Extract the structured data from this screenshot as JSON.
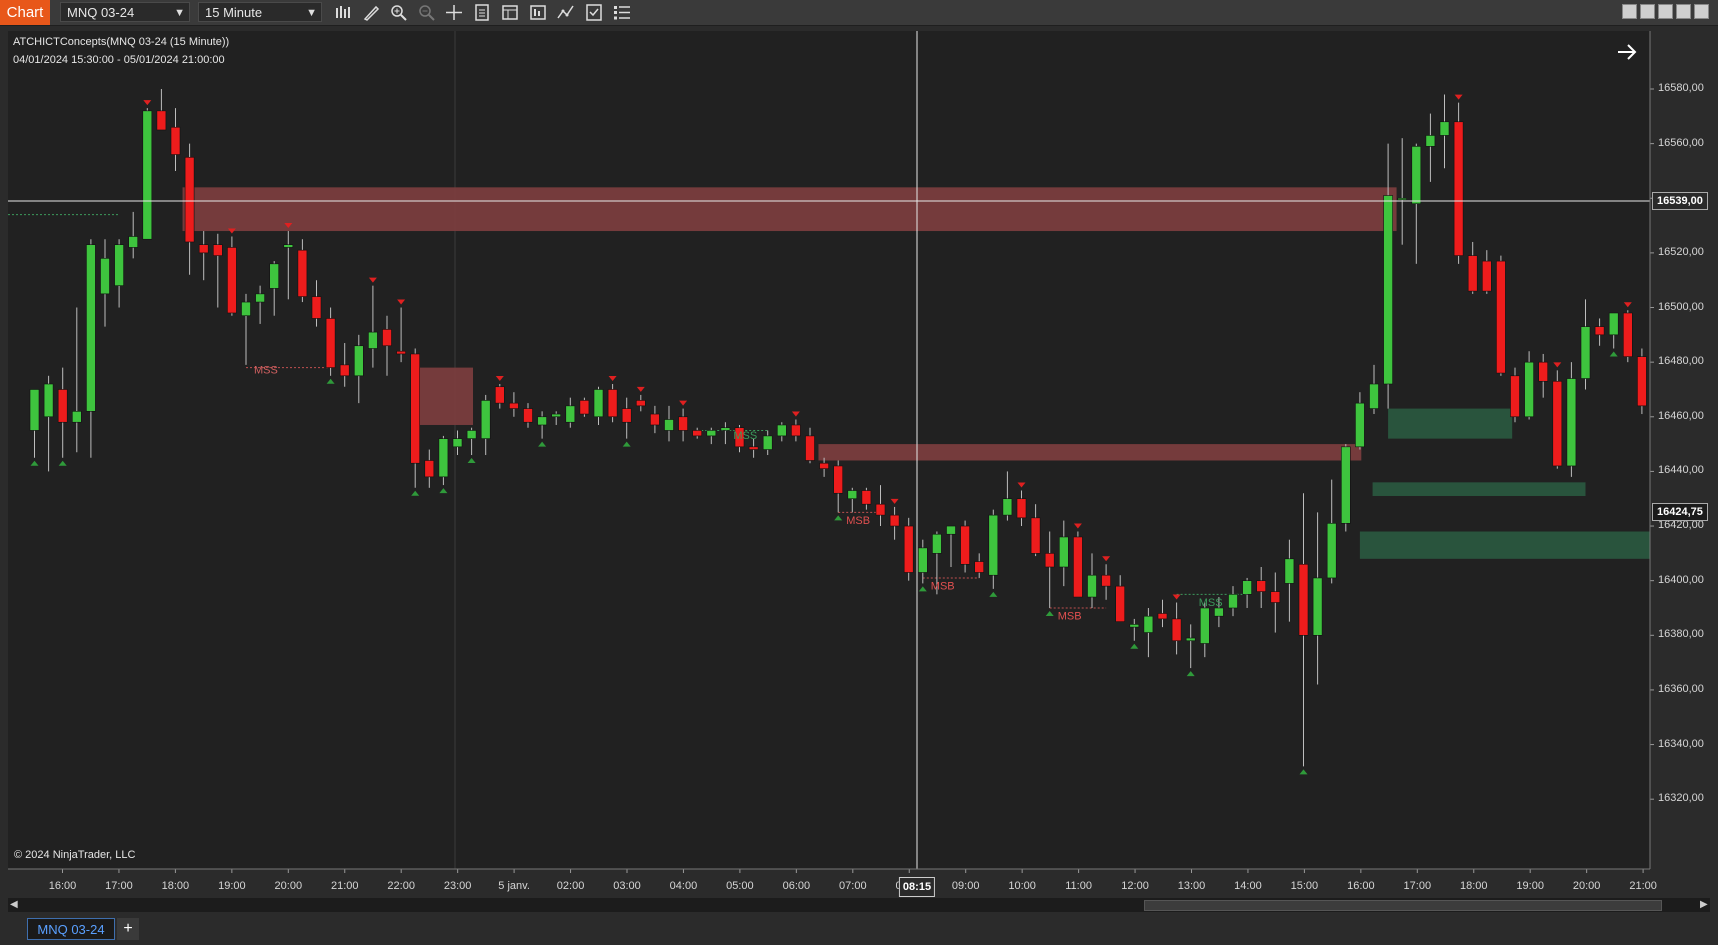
{
  "toolbar": {
    "chart_button": "Chart",
    "instrument_select": "MNQ 03-24",
    "interval_select": "15 Minute",
    "icons": [
      "bar-type-icon",
      "drawing-tools-icon",
      "zoom-in-icon",
      "zoom-out-icon",
      "crosshair-icon",
      "data-box-icon",
      "chart-style-icon",
      "templates-icon",
      "indicators-icon",
      "strategies-icon",
      "properties-icon"
    ]
  },
  "chart": {
    "indicator_title": "ATCHICTConcepts(MNQ 03-24 (15 Minute))",
    "date_range": "04/01/2024 15:30:00 - 05/01/2024 21:00:00",
    "copyright": "© 2024 NinjaTrader, LLC",
    "crosshair_price_tag": "16539,00",
    "last_price_tag": "16424,75",
    "crosshair_time_tag": "08:15",
    "colors": {
      "background": "#212121",
      "up_candle": "#3ec43e",
      "down_candle": "#ee1c1c",
      "bearish_zone": "#7a3d3e",
      "bullish_zone": "#2a5a40",
      "msb_label": "#e05050",
      "mss_bear_label": "#d06060",
      "mss_bull_label": "#3c9a5c"
    }
  },
  "y_axis": {
    "labels": [
      "16580,00",
      "16560,00",
      "16540,00",
      "16520,00",
      "16500,00",
      "16480,00",
      "16460,00",
      "16440,00",
      "16420,00",
      "16400,00",
      "16380,00",
      "16360,00",
      "16340,00",
      "16320,00"
    ],
    "values": [
      16580,
      16560,
      16540,
      16520,
      16500,
      16480,
      16460,
      16440,
      16420,
      16400,
      16380,
      16360,
      16340,
      16320
    ]
  },
  "x_axis": {
    "labels": [
      "16:00",
      "17:00",
      "18:00",
      "19:00",
      "20:00",
      "21:00",
      "22:00",
      "23:00",
      "5 janv.",
      "02:00",
      "03:00",
      "04:00",
      "05:00",
      "06:00",
      "07:00",
      "08:00",
      "09:00",
      "10:00",
      "11:00",
      "12:00",
      "13:00",
      "14:00",
      "15:00",
      "16:00",
      "17:00",
      "18:00",
      "19:00",
      "20:00",
      "21:00"
    ],
    "hour_offsets": [
      0.5,
      1.5,
      2.5,
      3.5,
      4.5,
      5.5,
      6.5,
      7.5,
      8.5,
      9.5,
      10.5,
      11.5,
      12.5,
      13.5,
      14.5,
      15.5,
      16.5,
      17.5,
      18.5,
      19.5,
      20.5,
      21.5,
      22.5,
      23.5,
      24.5,
      25.5,
      26.5,
      27.5,
      28.5
    ]
  },
  "annotations": [
    {
      "text": "MSS",
      "bar": 15,
      "price": 16478
    },
    {
      "text": "MSS",
      "bar": 49,
      "price": 16454
    },
    {
      "text": "MSB",
      "bar": 57,
      "price": 16423
    },
    {
      "text": "MSB",
      "bar": 63,
      "price": 16399
    },
    {
      "text": "MSB",
      "bar": 72,
      "price": 16388
    },
    {
      "text": "MSS",
      "bar": 82,
      "price": 16393
    }
  ],
  "chart_data": {
    "type": "candlestick",
    "y_range": [
      16320,
      16590
    ],
    "bars": [
      {
        "o": 16455,
        "h": 16468,
        "l": 16445,
        "c": 16470
      },
      {
        "o": 16460,
        "h": 16475,
        "l": 16440,
        "c": 16472
      },
      {
        "o": 16470,
        "h": 16478,
        "l": 16445,
        "c": 16458
      },
      {
        "o": 16458,
        "h": 16500,
        "l": 16447,
        "c": 16462
      },
      {
        "o": 16462,
        "h": 16525,
        "l": 16445,
        "c": 16523
      },
      {
        "o": 16505,
        "h": 16525,
        "l": 16493,
        "c": 16518
      },
      {
        "o": 16508,
        "h": 16525,
        "l": 16500,
        "c": 16523
      },
      {
        "o": 16522,
        "h": 16535,
        "l": 16518,
        "c": 16526
      },
      {
        "o": 16525,
        "h": 16573,
        "l": 16525,
        "c": 16572
      },
      {
        "o": 16572,
        "h": 16580,
        "l": 16566,
        "c": 16565
      },
      {
        "o": 16566,
        "h": 16573,
        "l": 16550,
        "c": 16556
      },
      {
        "o": 16555,
        "h": 16560,
        "l": 16512,
        "c": 16524
      },
      {
        "o": 16523,
        "h": 16528,
        "l": 16510,
        "c": 16520
      },
      {
        "o": 16523,
        "h": 16527,
        "l": 16500,
        "c": 16519
      },
      {
        "o": 16522,
        "h": 16526,
        "l": 16497,
        "c": 16498
      },
      {
        "o": 16497,
        "h": 16505,
        "l": 16479,
        "c": 16502
      },
      {
        "o": 16502,
        "h": 16508,
        "l": 16494,
        "c": 16505
      },
      {
        "o": 16507,
        "h": 16517,
        "l": 16497,
        "c": 16516
      },
      {
        "o": 16522,
        "h": 16528,
        "l": 16503,
        "c": 16523
      },
      {
        "o": 16521,
        "h": 16525,
        "l": 16502,
        "c": 16504
      },
      {
        "o": 16504,
        "h": 16510,
        "l": 16493,
        "c": 16496
      },
      {
        "o": 16496,
        "h": 16500,
        "l": 16475,
        "c": 16478
      },
      {
        "o": 16479,
        "h": 16487,
        "l": 16471,
        "c": 16475
      },
      {
        "o": 16475,
        "h": 16490,
        "l": 16465,
        "c": 16486
      },
      {
        "o": 16485,
        "h": 16508,
        "l": 16478,
        "c": 16491
      },
      {
        "o": 16492,
        "h": 16497,
        "l": 16475,
        "c": 16486
      },
      {
        "o": 16484,
        "h": 16500,
        "l": 16480,
        "c": 16483
      },
      {
        "o": 16483,
        "h": 16485,
        "l": 16434,
        "c": 16443
      },
      {
        "o": 16444,
        "h": 16448,
        "l": 16434,
        "c": 16438
      },
      {
        "o": 16438,
        "h": 16453,
        "l": 16435,
        "c": 16452
      },
      {
        "o": 16449,
        "h": 16455,
        "l": 16446,
        "c": 16452
      },
      {
        "o": 16452,
        "h": 16456,
        "l": 16446,
        "c": 16455
      },
      {
        "o": 16452,
        "h": 16468,
        "l": 16446,
        "c": 16466
      },
      {
        "o": 16471,
        "h": 16472,
        "l": 16463,
        "c": 16465
      },
      {
        "o": 16465,
        "h": 16469,
        "l": 16460,
        "c": 16463
      },
      {
        "o": 16463,
        "h": 16465,
        "l": 16456,
        "c": 16458
      },
      {
        "o": 16457,
        "h": 16462,
        "l": 16452,
        "c": 16460
      },
      {
        "o": 16460,
        "h": 16462,
        "l": 16457,
        "c": 16461
      },
      {
        "o": 16458,
        "h": 16467,
        "l": 16456,
        "c": 16464
      },
      {
        "o": 16466,
        "h": 16467,
        "l": 16460,
        "c": 16461
      },
      {
        "o": 16460,
        "h": 16471,
        "l": 16457,
        "c": 16470
      },
      {
        "o": 16470,
        "h": 16472,
        "l": 16458,
        "c": 16460
      },
      {
        "o": 16463,
        "h": 16467,
        "l": 16452,
        "c": 16458
      },
      {
        "o": 16466,
        "h": 16468,
        "l": 16462,
        "c": 16464
      },
      {
        "o": 16461,
        "h": 16464,
        "l": 16454,
        "c": 16457
      },
      {
        "o": 16455,
        "h": 16464,
        "l": 16451,
        "c": 16459
      },
      {
        "o": 16460,
        "h": 16463,
        "l": 16451,
        "c": 16455
      },
      {
        "o": 16455,
        "h": 16456,
        "l": 16452,
        "c": 16453
      },
      {
        "o": 16453,
        "h": 16456,
        "l": 16450,
        "c": 16455
      },
      {
        "o": 16455,
        "h": 16458,
        "l": 16450,
        "c": 16456
      },
      {
        "o": 16456,
        "h": 16457,
        "l": 16447,
        "c": 16449
      },
      {
        "o": 16449,
        "h": 16452,
        "l": 16445,
        "c": 16448
      },
      {
        "o": 16448,
        "h": 16455,
        "l": 16446,
        "c": 16453
      },
      {
        "o": 16453,
        "h": 16458,
        "l": 16451,
        "c": 16457
      },
      {
        "o": 16457,
        "h": 16459,
        "l": 16451,
        "c": 16453
      },
      {
        "o": 16453,
        "h": 16456,
        "l": 16443,
        "c": 16444
      },
      {
        "o": 16443,
        "h": 16445,
        "l": 16438,
        "c": 16441
      },
      {
        "o": 16442,
        "h": 16444,
        "l": 16425,
        "c": 16432
      },
      {
        "o": 16430,
        "h": 16434,
        "l": 16425,
        "c": 16433
      },
      {
        "o": 16433,
        "h": 16434,
        "l": 16426,
        "c": 16428
      },
      {
        "o": 16428,
        "h": 16435,
        "l": 16420,
        "c": 16424
      },
      {
        "o": 16424,
        "h": 16427,
        "l": 16415,
        "c": 16420
      },
      {
        "o": 16420,
        "h": 16423,
        "l": 16400,
        "c": 16403
      },
      {
        "o": 16403,
        "h": 16415,
        "l": 16399,
        "c": 16412
      },
      {
        "o": 16410,
        "h": 16418,
        "l": 16395,
        "c": 16417
      },
      {
        "o": 16417,
        "h": 16420,
        "l": 16405,
        "c": 16420
      },
      {
        "o": 16420,
        "h": 16422,
        "l": 16403,
        "c": 16406
      },
      {
        "o": 16407,
        "h": 16410,
        "l": 16401,
        "c": 16403
      },
      {
        "o": 16402,
        "h": 16426,
        "l": 16397,
        "c": 16424
      },
      {
        "o": 16424,
        "h": 16440,
        "l": 16422,
        "c": 16430
      },
      {
        "o": 16430,
        "h": 16433,
        "l": 16420,
        "c": 16423
      },
      {
        "o": 16423,
        "h": 16428,
        "l": 16409,
        "c": 16410
      },
      {
        "o": 16410,
        "h": 16418,
        "l": 16390,
        "c": 16405
      },
      {
        "o": 16405,
        "h": 16422,
        "l": 16398,
        "c": 16416
      },
      {
        "o": 16416,
        "h": 16418,
        "l": 16399,
        "c": 16394
      },
      {
        "o": 16394,
        "h": 16410,
        "l": 16390,
        "c": 16402
      },
      {
        "o": 16402,
        "h": 16406,
        "l": 16393,
        "c": 16398
      },
      {
        "o": 16398,
        "h": 16402,
        "l": 16385,
        "c": 16385
      },
      {
        "o": 16383,
        "h": 16386,
        "l": 16378,
        "c": 16384
      },
      {
        "o": 16381,
        "h": 16390,
        "l": 16372,
        "c": 16387
      },
      {
        "o": 16388,
        "h": 16393,
        "l": 16383,
        "c": 16386
      },
      {
        "o": 16386,
        "h": 16392,
        "l": 16373,
        "c": 16378
      },
      {
        "o": 16378,
        "h": 16384,
        "l": 16368,
        "c": 16379
      },
      {
        "o": 16377,
        "h": 16392,
        "l": 16372,
        "c": 16390
      },
      {
        "o": 16387,
        "h": 16394,
        "l": 16383,
        "c": 16390
      },
      {
        "o": 16390,
        "h": 16398,
        "l": 16387,
        "c": 16395
      },
      {
        "o": 16395,
        "h": 16401,
        "l": 16390,
        "c": 16400
      },
      {
        "o": 16400,
        "h": 16405,
        "l": 16390,
        "c": 16396
      },
      {
        "o": 16396,
        "h": 16403,
        "l": 16381,
        "c": 16392
      },
      {
        "o": 16399,
        "h": 16415,
        "l": 16385,
        "c": 16408
      },
      {
        "o": 16406,
        "h": 16432,
        "l": 16332,
        "c": 16380
      },
      {
        "o": 16380,
        "h": 16425,
        "l": 16362,
        "c": 16401
      },
      {
        "o": 16401,
        "h": 16437,
        "l": 16399,
        "c": 16421
      },
      {
        "o": 16421,
        "h": 16450,
        "l": 16418,
        "c": 16449
      },
      {
        "o": 16449,
        "h": 16469,
        "l": 16448,
        "c": 16465
      },
      {
        "o": 16463,
        "h": 16479,
        "l": 16461,
        "c": 16472
      },
      {
        "o": 16472,
        "h": 16560,
        "l": 16463,
        "c": 16541
      },
      {
        "o": 16540,
        "h": 16562,
        "l": 16523,
        "c": 16540
      },
      {
        "o": 16538,
        "h": 16560,
        "l": 16516,
        "c": 16559
      },
      {
        "o": 16559,
        "h": 16571,
        "l": 16546,
        "c": 16563
      },
      {
        "o": 16563,
        "h": 16578,
        "l": 16551,
        "c": 16568
      },
      {
        "o": 16568,
        "h": 16575,
        "l": 16516,
        "c": 16519
      },
      {
        "o": 16519,
        "h": 16524,
        "l": 16505,
        "c": 16506
      },
      {
        "o": 16517,
        "h": 16521,
        "l": 16505,
        "c": 16506
      },
      {
        "o": 16517,
        "h": 16519,
        "l": 16475,
        "c": 16476
      },
      {
        "o": 16475,
        "h": 16478,
        "l": 16458,
        "c": 16460
      },
      {
        "o": 16460,
        "h": 16484,
        "l": 16459,
        "c": 16480
      },
      {
        "o": 16480,
        "h": 16483,
        "l": 16467,
        "c": 16473
      },
      {
        "o": 16473,
        "h": 16477,
        "l": 16441,
        "c": 16442
      },
      {
        "o": 16442,
        "h": 16480,
        "l": 16438,
        "c": 16474
      },
      {
        "o": 16474,
        "h": 16503,
        "l": 16470,
        "c": 16493
      },
      {
        "o": 16493,
        "h": 16496,
        "l": 16486,
        "c": 16490
      },
      {
        "o": 16490,
        "h": 16497,
        "l": 16485,
        "c": 16498
      },
      {
        "o": 16498,
        "h": 16499,
        "l": 16480,
        "c": 16482
      },
      {
        "o": 16482,
        "h": 16485,
        "l": 16461,
        "c": 16464
      },
      {
        "o": 16462,
        "h": 16469,
        "l": 16421,
        "c": 16425
      }
    ],
    "zones": [
      {
        "kind": "bearish",
        "from_bar": 10.5,
        "to_bar": 96.6,
        "top": 16544,
        "bottom": 16528
      },
      {
        "kind": "bearish",
        "from_bar": 27.3,
        "to_bar": 31.1,
        "top": 16478,
        "bottom": 16457
      },
      {
        "kind": "bearish",
        "from_bar": 55.6,
        "to_bar": 94.1,
        "top": 16450,
        "bottom": 16444
      },
      {
        "kind": "bullish",
        "from_bar": 96.0,
        "to_bar": 104.8,
        "top": 16463,
        "bottom": 16452
      },
      {
        "kind": "bullish",
        "from_bar": 94.9,
        "to_bar": 110.0,
        "top": 16436,
        "bottom": 16431
      },
      {
        "kind": "bullish",
        "from_bar": 94.0,
        "to_bar": 116.6,
        "top": 16418,
        "bottom": 16408
      }
    ],
    "swing_highs": [
      8,
      14,
      18,
      24,
      26,
      33,
      41,
      43,
      46,
      54,
      61,
      70,
      74,
      76,
      81,
      101,
      108,
      113
    ],
    "swing_lows": [
      0,
      2,
      21,
      27,
      29,
      31,
      36,
      42,
      57,
      63,
      68,
      72,
      78,
      82,
      90,
      112
    ],
    "crosshair": {
      "bar": 62.3,
      "price": 16539
    }
  }
}
